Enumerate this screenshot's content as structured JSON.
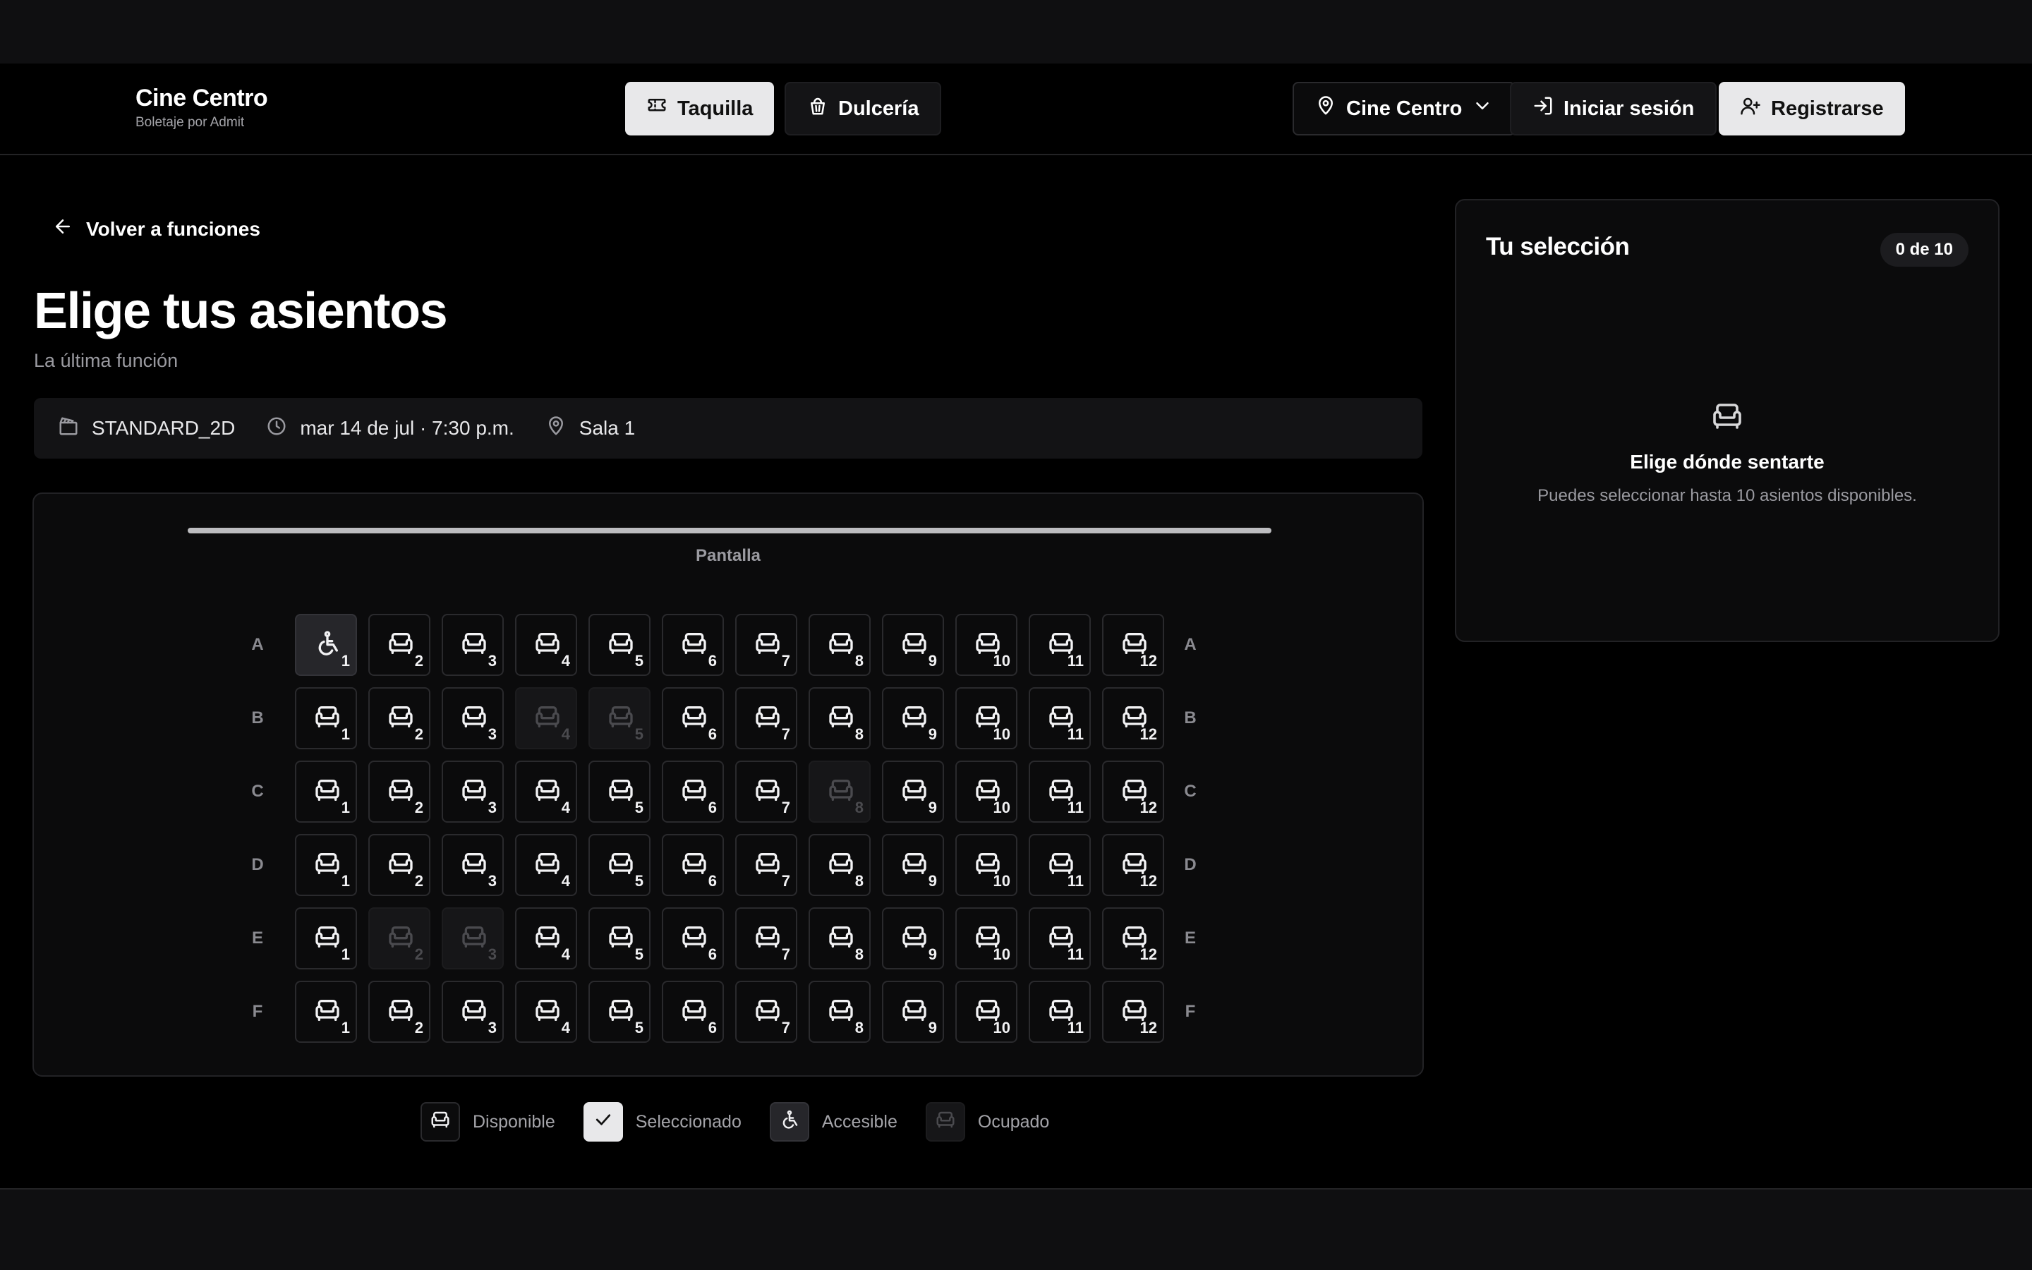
{
  "header": {
    "brand_name": "Cine Centro",
    "brand_sub": "Boletaje por Admit",
    "nav": {
      "taquilla": "Taquilla",
      "dulceria": "Dulcería"
    },
    "location": "Cine Centro",
    "login": "Iniciar sesión",
    "register": "Registrarse"
  },
  "page": {
    "back": "Volver a funciones",
    "title": "Elige tus asientos",
    "subtitle": "La última función"
  },
  "info": {
    "format": "STANDARD_2D",
    "datetime": "mar 14 de jul · 7:30 p.m.",
    "room": "Sala 1"
  },
  "seatmap": {
    "screen_label": "Pantalla",
    "rows": [
      {
        "label": "A",
        "seats": [
          {
            "n": "1",
            "s": "accessible"
          },
          {
            "n": "2",
            "s": "available"
          },
          {
            "n": "3",
            "s": "available"
          },
          {
            "n": "4",
            "s": "available"
          },
          {
            "n": "5",
            "s": "available"
          },
          {
            "n": "6",
            "s": "available"
          },
          {
            "n": "7",
            "s": "available"
          },
          {
            "n": "8",
            "s": "available"
          },
          {
            "n": "9",
            "s": "available"
          },
          {
            "n": "10",
            "s": "available"
          },
          {
            "n": "11",
            "s": "available"
          },
          {
            "n": "12",
            "s": "available"
          }
        ]
      },
      {
        "label": "B",
        "seats": [
          {
            "n": "1",
            "s": "available"
          },
          {
            "n": "2",
            "s": "available"
          },
          {
            "n": "3",
            "s": "available"
          },
          {
            "n": "4",
            "s": "occupied"
          },
          {
            "n": "5",
            "s": "occupied"
          },
          {
            "n": "6",
            "s": "available"
          },
          {
            "n": "7",
            "s": "available"
          },
          {
            "n": "8",
            "s": "available"
          },
          {
            "n": "9",
            "s": "available"
          },
          {
            "n": "10",
            "s": "available"
          },
          {
            "n": "11",
            "s": "available"
          },
          {
            "n": "12",
            "s": "available"
          }
        ]
      },
      {
        "label": "C",
        "seats": [
          {
            "n": "1",
            "s": "available"
          },
          {
            "n": "2",
            "s": "available"
          },
          {
            "n": "3",
            "s": "available"
          },
          {
            "n": "4",
            "s": "available"
          },
          {
            "n": "5",
            "s": "available"
          },
          {
            "n": "6",
            "s": "available"
          },
          {
            "n": "7",
            "s": "available"
          },
          {
            "n": "8",
            "s": "occupied"
          },
          {
            "n": "9",
            "s": "available"
          },
          {
            "n": "10",
            "s": "available"
          },
          {
            "n": "11",
            "s": "available"
          },
          {
            "n": "12",
            "s": "available"
          }
        ]
      },
      {
        "label": "D",
        "seats": [
          {
            "n": "1",
            "s": "available"
          },
          {
            "n": "2",
            "s": "available"
          },
          {
            "n": "3",
            "s": "available"
          },
          {
            "n": "4",
            "s": "available"
          },
          {
            "n": "5",
            "s": "available"
          },
          {
            "n": "6",
            "s": "available"
          },
          {
            "n": "7",
            "s": "available"
          },
          {
            "n": "8",
            "s": "available"
          },
          {
            "n": "9",
            "s": "available"
          },
          {
            "n": "10",
            "s": "available"
          },
          {
            "n": "11",
            "s": "available"
          },
          {
            "n": "12",
            "s": "available"
          }
        ]
      },
      {
        "label": "E",
        "seats": [
          {
            "n": "1",
            "s": "available"
          },
          {
            "n": "2",
            "s": "occupied"
          },
          {
            "n": "3",
            "s": "occupied"
          },
          {
            "n": "4",
            "s": "available"
          },
          {
            "n": "5",
            "s": "available"
          },
          {
            "n": "6",
            "s": "available"
          },
          {
            "n": "7",
            "s": "available"
          },
          {
            "n": "8",
            "s": "available"
          },
          {
            "n": "9",
            "s": "available"
          },
          {
            "n": "10",
            "s": "available"
          },
          {
            "n": "11",
            "s": "available"
          },
          {
            "n": "12",
            "s": "available"
          }
        ]
      },
      {
        "label": "F",
        "seats": [
          {
            "n": "1",
            "s": "available"
          },
          {
            "n": "2",
            "s": "available"
          },
          {
            "n": "3",
            "s": "available"
          },
          {
            "n": "4",
            "s": "available"
          },
          {
            "n": "5",
            "s": "available"
          },
          {
            "n": "6",
            "s": "available"
          },
          {
            "n": "7",
            "s": "available"
          },
          {
            "n": "8",
            "s": "available"
          },
          {
            "n": "9",
            "s": "available"
          },
          {
            "n": "10",
            "s": "available"
          },
          {
            "n": "11",
            "s": "available"
          },
          {
            "n": "12",
            "s": "available"
          }
        ]
      }
    ]
  },
  "legend": {
    "available": "Disponible",
    "selected": "Seleccionado",
    "accessible": "Accesible",
    "occupied": "Ocupado"
  },
  "selection": {
    "title": "Tu selección",
    "count": "0 de 10",
    "empty_title": "Elige dónde sentarte",
    "empty_desc": "Puedes seleccionar hasta 10 asientos disponibles."
  }
}
